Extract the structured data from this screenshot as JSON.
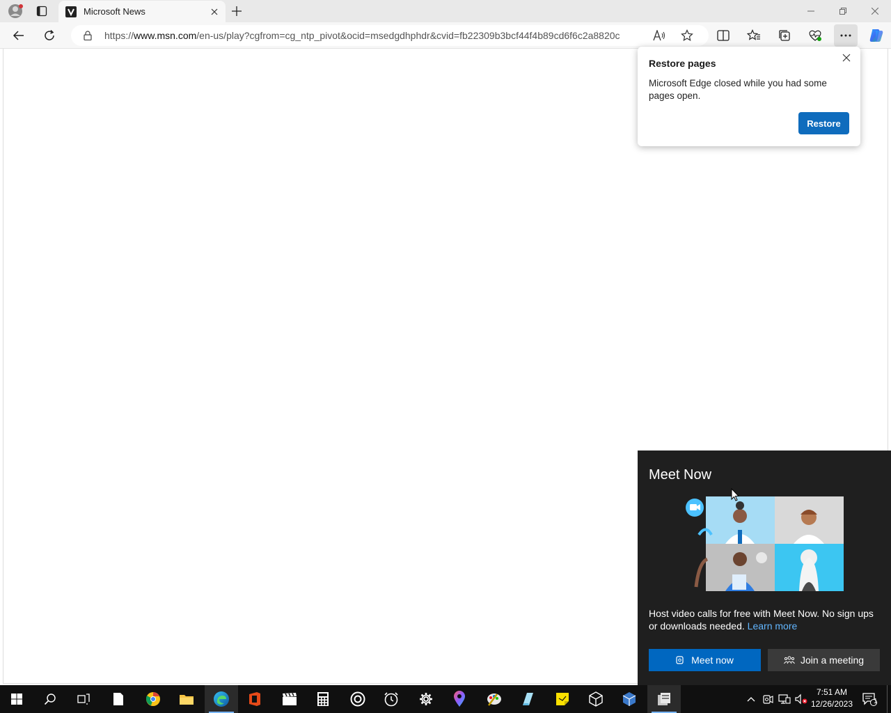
{
  "browser": {
    "tab": {
      "title": "Microsoft News"
    },
    "address": {
      "prefix": "https://",
      "domain": "www.msn.com",
      "path": "/en-us/play?cgfrom=cg_ntp_pivot&ocid=msedgdhphdr&cvid=fb22309b3bcf44f4b89cd6f6c2a8820c"
    }
  },
  "restore_popup": {
    "title": "Restore pages",
    "message": "Microsoft Edge closed while you had some pages open.",
    "button": "Restore"
  },
  "meet_now": {
    "title": "Meet Now",
    "description": "Host video calls for free with Meet Now. No sign ups or downloads needed.",
    "learn_more": "Learn more",
    "meet_button": "Meet now",
    "join_button": "Join a meeting"
  },
  "taskbar": {
    "time": "7:51 AM",
    "date": "12/26/2023",
    "notification_count": "1"
  },
  "colors": {
    "accent": "#0f6cbd",
    "meet_accent": "#0067c0",
    "link": "#62b6ff"
  }
}
